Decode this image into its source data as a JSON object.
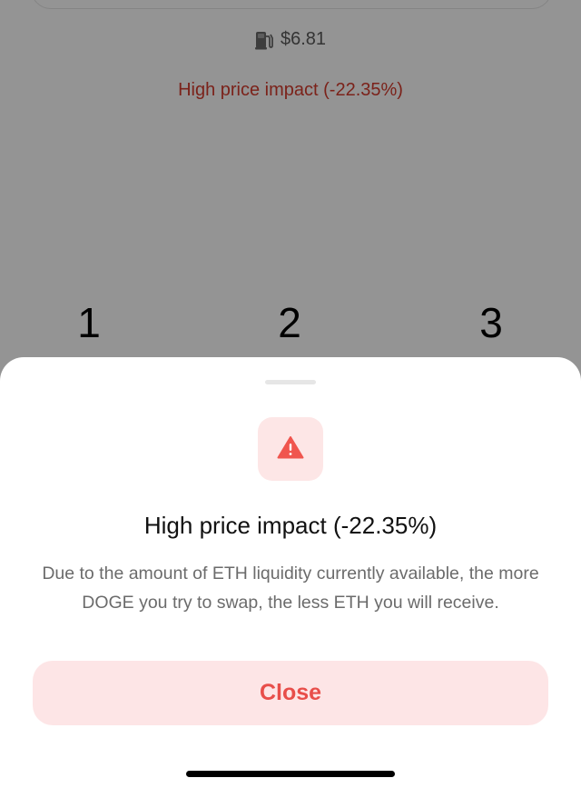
{
  "background": {
    "gas_fee": "$6.81",
    "gas_icon": "gas-pump-icon",
    "price_impact_notice": "High price impact (-22.35%)",
    "keypad": [
      "1",
      "2",
      "3"
    ]
  },
  "sheet": {
    "warning_icon": "warning-triangle-icon",
    "title": "High price impact (-22.35%)",
    "body": "Due to the amount of ETH liquidity currently available, the more DOGE you try to swap, the less ETH you will receive.",
    "close_label": "Close"
  },
  "colors": {
    "warning_red": "#d43c2e",
    "accent": "#e84e4a",
    "accent_soft": "#fde5e6",
    "icon_red": "#f0554e"
  }
}
